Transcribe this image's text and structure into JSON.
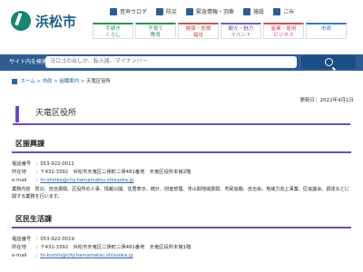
{
  "header": {
    "logo_text": "浜松市",
    "util": [
      "音声ウロゲ",
      "防災",
      "緊急情報・羽奉",
      "施設",
      "ごみ"
    ],
    "tiles": [
      [
        "手続き",
        "くらし"
      ],
      [
        "子育て",
        "教育"
      ],
      [
        "健康・医療",
        "福祉"
      ],
      [
        "観光・魅力",
        "イベント"
      ],
      [
        "産業・雇用",
        "ビジネス"
      ],
      [
        "市政"
      ]
    ],
    "tile_colors": [
      "#2f8f58",
      "#2f8f58",
      "#c05b4e",
      "#6d5fb3",
      "#d04e60",
      "#2f7cc3"
    ]
  },
  "search": {
    "label": "サイト内を検索",
    "placeholder": "ヨロゴの出しか、転入届、マイナンバー"
  },
  "breadcrumb": {
    "items": [
      "ホーム",
      "市政",
      "組織案内",
      "天竜区役所"
    ]
  },
  "page": {
    "updated": "更新日：2022年4月1日",
    "title": "天竜区役所"
  },
  "sections": [
    {
      "heading": "区振興課",
      "phone": "053-922-0011",
      "address": "〒431-3392　浜松市天竜区二俣町二俣481番地　天竜区役所本館2階",
      "email": "tn-shinko@city.hamamatsu.shizuoka.jp",
      "duties": "業務内容　防災、自治振興、区役所の人事、情報公開、住居表示、統計、財産管理、市山間地域振興、市民協働、自治会、地域力向上事業、区協議会、調達などに関する業務を行います。"
    },
    {
      "heading": "区民生活課",
      "phone": "053-922-0019",
      "address": "〒431-3392　浜松市天竜区二俣町二俣481番地　天竜区役所本館1階",
      "email": "tn-kumin@city.hamamatsu.shizuoka.jp",
      "duties": ""
    }
  ],
  "labels": {
    "phone": "電話番号",
    "address": "所在地",
    "email": "e-mail"
  },
  "colors": {
    "brand": "#16846f",
    "search_bar": "#2f5d93",
    "accent": "#6f4bb8",
    "link": "#2c64a6"
  }
}
